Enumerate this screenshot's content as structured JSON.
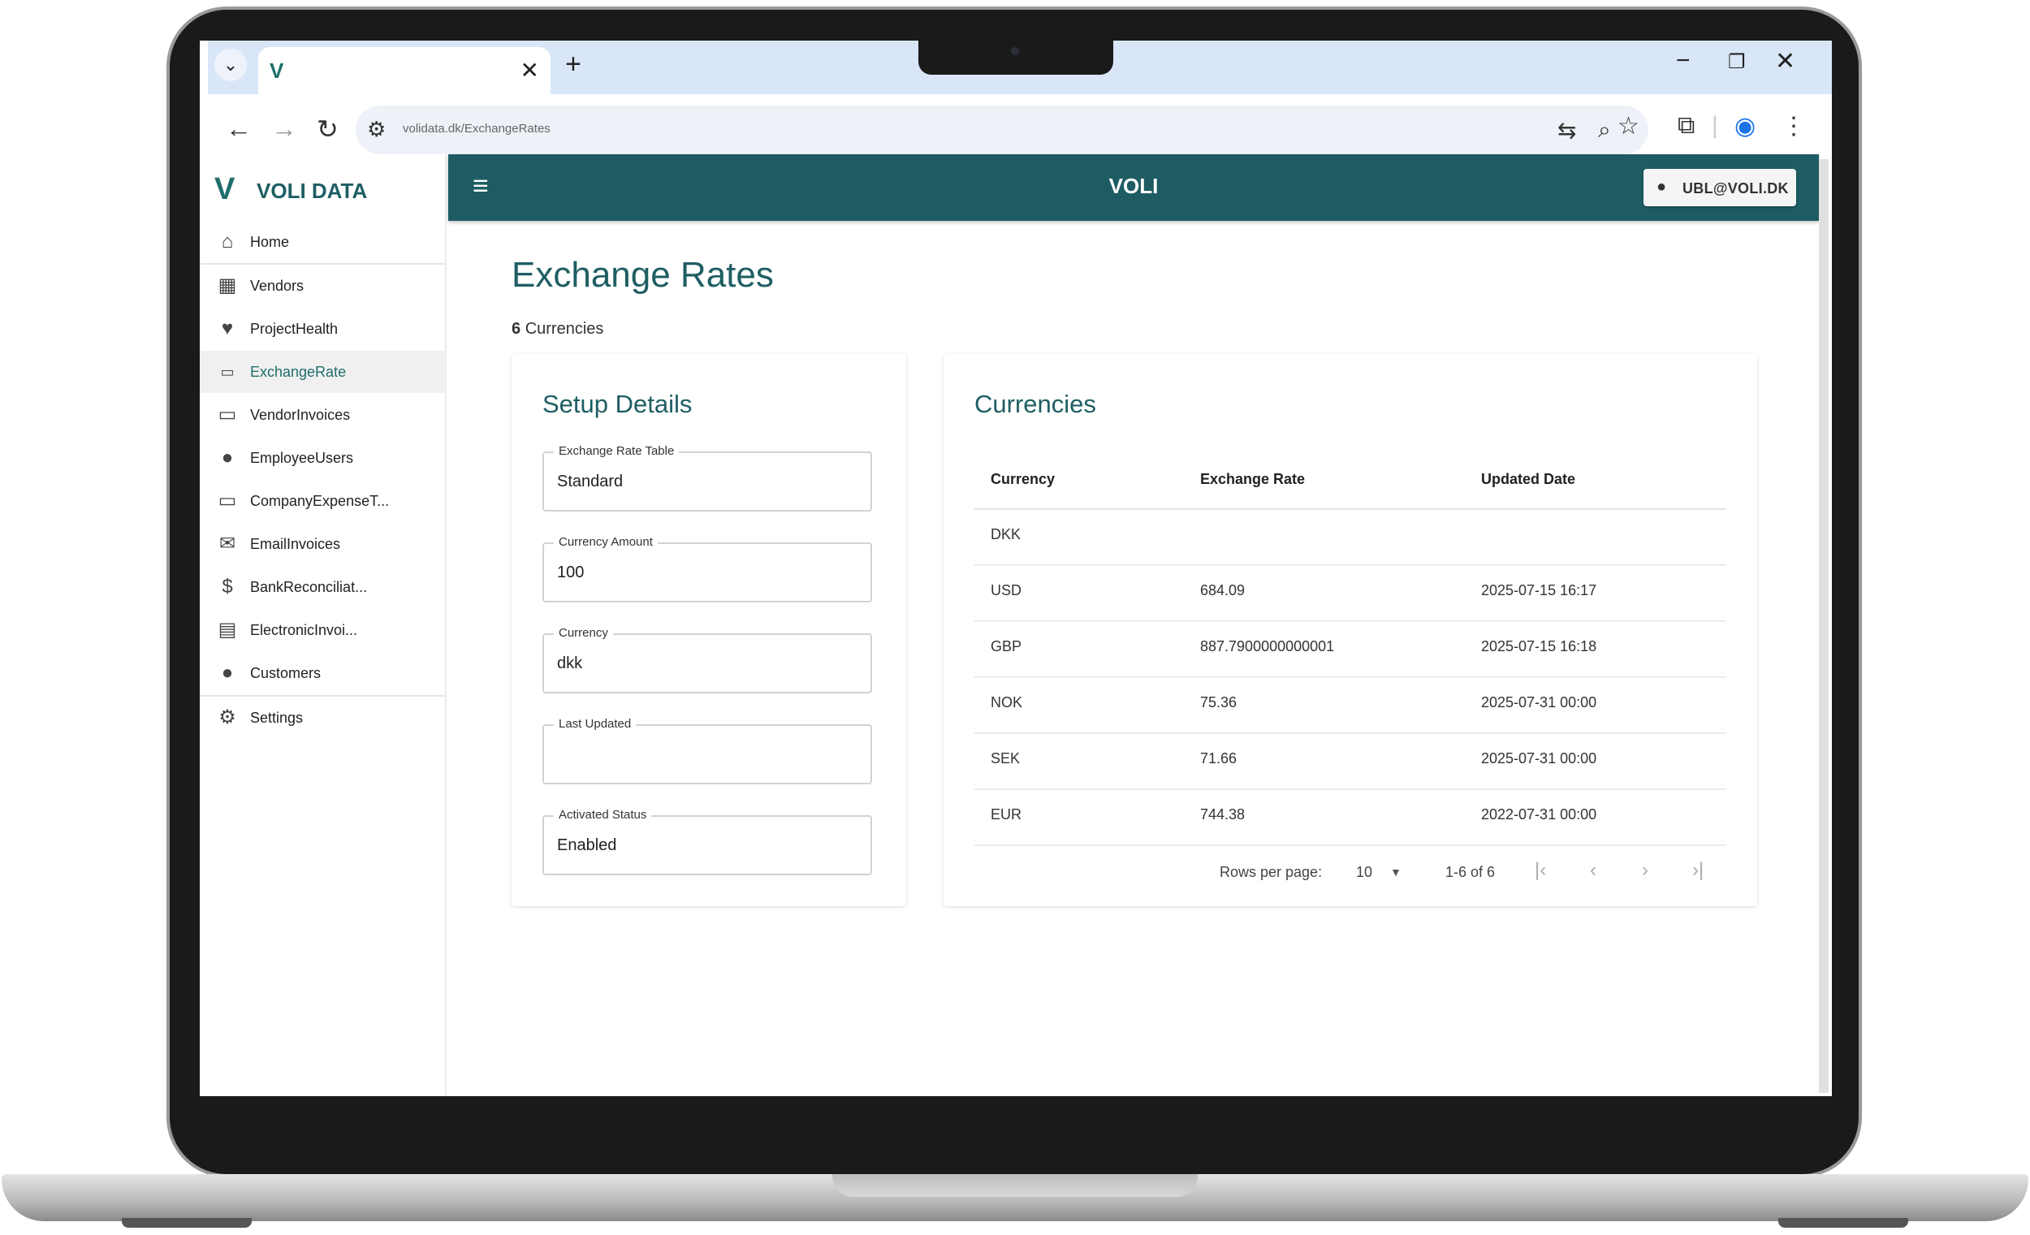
{
  "browser": {
    "tab_title": "",
    "url": "volidata.dk/ExchangeRates",
    "new_tab_symbol": "+",
    "icons": [
      "chevron-down-icon",
      "close-icon",
      "minimize-icon",
      "restore-icon",
      "back-icon",
      "forward-icon",
      "reload-icon",
      "site-info-icon",
      "translate-icon",
      "zoom-icon",
      "star-icon",
      "extensions-icon",
      "profile-icon",
      "menu-icon"
    ]
  },
  "sidebar": {
    "brand": "VOLI DATA",
    "items": [
      {
        "label": "Home",
        "icon": "home-icon"
      },
      {
        "label": "Vendors",
        "icon": "building-icon"
      },
      {
        "label": "ProjectHealth",
        "icon": "pulse-icon"
      },
      {
        "label": "ExchangeRate",
        "icon": "exchange-icon",
        "active": true
      },
      {
        "label": "VendorInvoices",
        "icon": "card-icon"
      },
      {
        "label": "EmployeeUsers",
        "icon": "person-icon"
      },
      {
        "label": "CompanyExpenseT...",
        "icon": "card-icon"
      },
      {
        "label": "EmailInvoices",
        "icon": "mail-icon"
      },
      {
        "label": "BankReconciliat...",
        "icon": "dollar-icon"
      },
      {
        "label": "ElectronicInvoi...",
        "icon": "document-icon"
      },
      {
        "label": "Customers",
        "icon": "person-icon"
      },
      {
        "label": "Settings",
        "icon": "gear-icon"
      }
    ]
  },
  "appbar": {
    "title": "VOLI",
    "user": "UBL@VOLI.DK"
  },
  "page": {
    "title": "Exchange Rates",
    "count": "6",
    "count_label": "Currencies"
  },
  "setup": {
    "title": "Setup Details",
    "fields": [
      {
        "label": "Exchange Rate Table",
        "value": "Standard"
      },
      {
        "label": "Currency Amount",
        "value": "100"
      },
      {
        "label": "Currency",
        "value": "dkk"
      },
      {
        "label": "Last Updated",
        "value": ""
      },
      {
        "label": "Activated Status",
        "value": "Enabled"
      }
    ]
  },
  "currencies": {
    "title": "Currencies",
    "columns": [
      "Currency",
      "Exchange Rate",
      "Updated Date"
    ],
    "rows": [
      {
        "currency": "DKK",
        "rate": "",
        "updated": ""
      },
      {
        "currency": "USD",
        "rate": "684.09",
        "updated": "2025-07-15 16:17"
      },
      {
        "currency": "GBP",
        "rate": "887.7900000000001",
        "updated": "2025-07-15 16:18"
      },
      {
        "currency": "NOK",
        "rate": "75.36",
        "updated": "2025-07-31 00:00"
      },
      {
        "currency": "SEK",
        "rate": "71.66",
        "updated": "2025-07-31 00:00"
      },
      {
        "currency": "EUR",
        "rate": "744.38",
        "updated": "2022-07-31 00:00"
      }
    ],
    "pagination": {
      "rows_per_page_label": "Rows per page:",
      "rows_per_page": "10",
      "range": "1-6 of 6"
    }
  }
}
